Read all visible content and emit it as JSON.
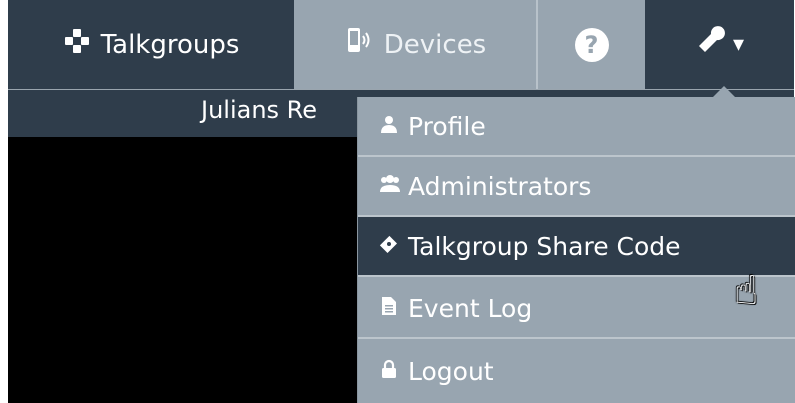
{
  "nav": {
    "talkgroups": {
      "label": "Talkgroups",
      "icon": "talkgroups-icon"
    },
    "devices": {
      "label": "Devices",
      "icon": "mobile-signal-icon"
    },
    "help": {
      "label": "?",
      "icon": "question-circle-icon"
    },
    "tools": {
      "icon": "wrench-icon",
      "caret": "▾"
    }
  },
  "subheader": {
    "title": "Julians Re"
  },
  "dropdown": {
    "items": [
      {
        "label": "Profile",
        "icon": "user-icon"
      },
      {
        "label": "Administrators",
        "icon": "users-icon"
      },
      {
        "label": "Talkgroup Share Code",
        "icon": "ticket-icon"
      },
      {
        "label": "Event Log",
        "icon": "file-icon"
      },
      {
        "label": "Logout",
        "icon": "lock-icon"
      }
    ],
    "highlighted": "Talkgroup Share Code"
  },
  "colors": {
    "dark": "#2f3d4b",
    "light": "#98a5b0",
    "text": "#ffffff"
  }
}
